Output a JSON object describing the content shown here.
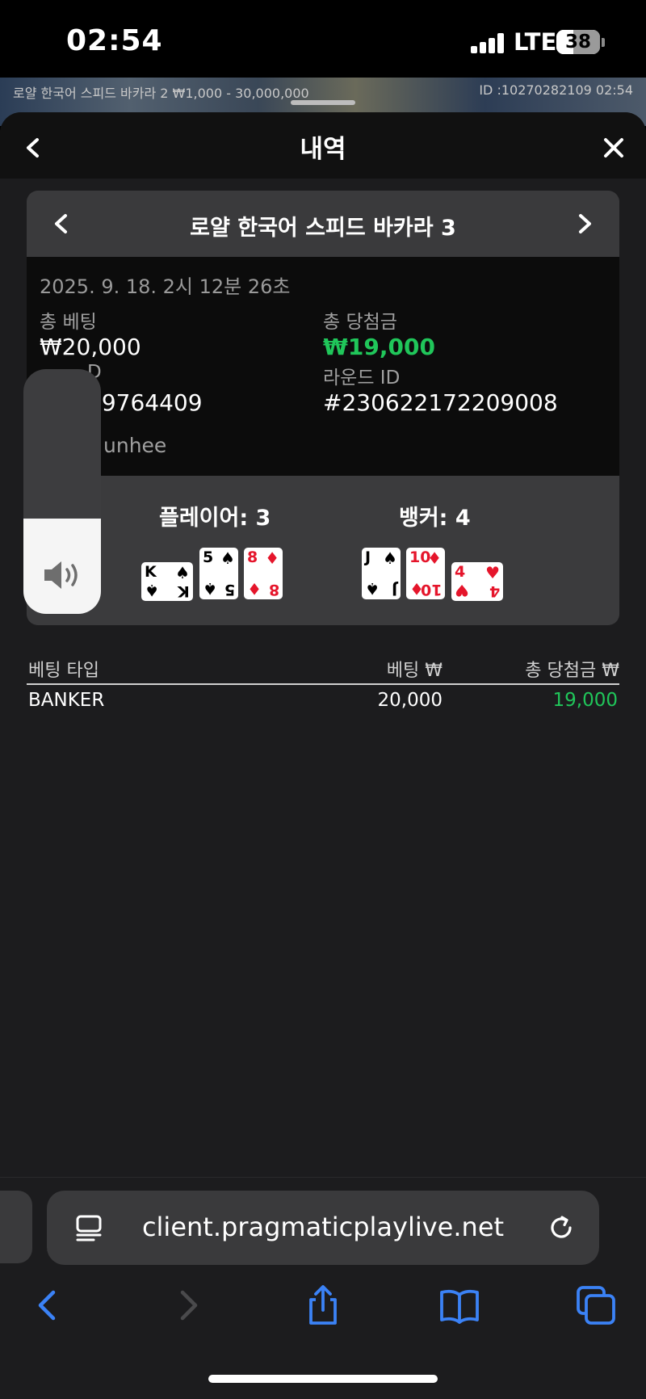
{
  "status_bar": {
    "time": "02:54",
    "network": "LTE",
    "battery": "38",
    "battery_level": 0.38
  },
  "background_game": {
    "left_text": "로얄 한국어 스피드 바카라 2 ₩1,000 - 30,000,000",
    "right_text": "ID :10270282109 02:54"
  },
  "sheet": {
    "title": "내역",
    "back_icon": "chevron-left-icon",
    "close_icon": "close-icon"
  },
  "round_card": {
    "game_title": "로얄 한국어 스피드 바카라 3",
    "datetime": "2025. 9. 18. 2시 12분 26초",
    "total_bet_label": "총 베팅",
    "total_bet": "₩20,000",
    "total_win_label": "총 당첨금",
    "total_win": "₩19,000",
    "partial_label": "D",
    "partial_id": "69764409",
    "round_id_label": "라운드 ID",
    "round_id": "#230622172209008",
    "partial_user": "unhee",
    "player_label": "플레이어: 3",
    "banker_label": "뱅커: 4",
    "player_cards": [
      {
        "rank": "K",
        "suit": "♠",
        "color": "black",
        "rotated": true
      },
      {
        "rank": "5",
        "suit": "♠",
        "color": "black",
        "rotated": false
      },
      {
        "rank": "8",
        "suit": "♦",
        "color": "red",
        "rotated": false
      }
    ],
    "banker_cards": [
      {
        "rank": "J",
        "suit": "♠",
        "color": "black",
        "rotated": false
      },
      {
        "rank": "10",
        "suit": "♦",
        "color": "red",
        "rotated": false
      },
      {
        "rank": "4",
        "suit": "♥",
        "color": "red",
        "rotated": true
      }
    ]
  },
  "volume": {
    "level": 0.39,
    "icon": "speaker-icon"
  },
  "bet_table": {
    "headers": [
      "베팅 타입",
      "베팅 ₩",
      "총 당첨금 ₩"
    ],
    "rows": [
      {
        "type": "BANKER",
        "bet": "20,000",
        "win": "19,000"
      }
    ]
  },
  "browser": {
    "url": "client.pragmaticplaylive.net",
    "toolbar_icons": [
      "back-arrow-icon",
      "forward-arrow-icon",
      "share-icon",
      "bookmarks-icon",
      "tabs-icon"
    ]
  },
  "colors": {
    "accent_green": "#20c65a",
    "ios_blue": "#3b82f6",
    "card_red": "#e5152b"
  }
}
